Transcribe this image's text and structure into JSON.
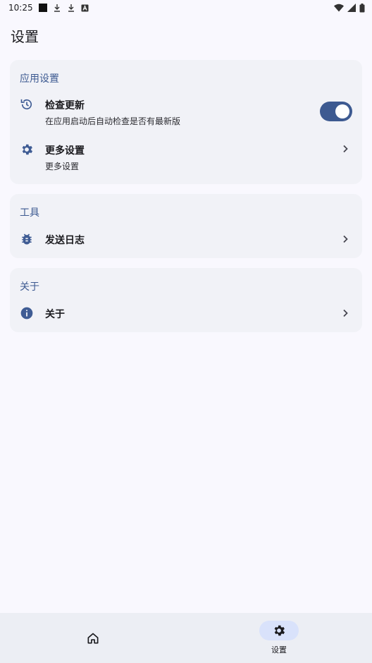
{
  "status_bar": {
    "time": "10:25"
  },
  "header": {
    "title": "设置"
  },
  "sections": {
    "app": {
      "title": "应用设置",
      "check_update": {
        "icon": "history-icon",
        "title": "检查更新",
        "subtitle": "在应用启动后自动检查是否有最新版",
        "enabled": true
      },
      "more_settings": {
        "icon": "gear-icon",
        "title": "更多设置",
        "subtitle": "更多设置"
      }
    },
    "tools": {
      "title": "工具",
      "send_log": {
        "icon": "bug-icon",
        "title": "发送日志"
      }
    },
    "about": {
      "title": "关于",
      "about_item": {
        "icon": "info-icon",
        "title": "关于"
      }
    }
  },
  "bottom_nav": {
    "items": [
      {
        "icon": "home-icon",
        "label": ""
      },
      {
        "icon": "gear-icon",
        "label": "设置",
        "active": true
      }
    ]
  },
  "colors": {
    "accent": "#3d5a91",
    "background": "#f9f8fe",
    "card": "#f1f2f7",
    "nav_active": "#d9e2fb"
  }
}
